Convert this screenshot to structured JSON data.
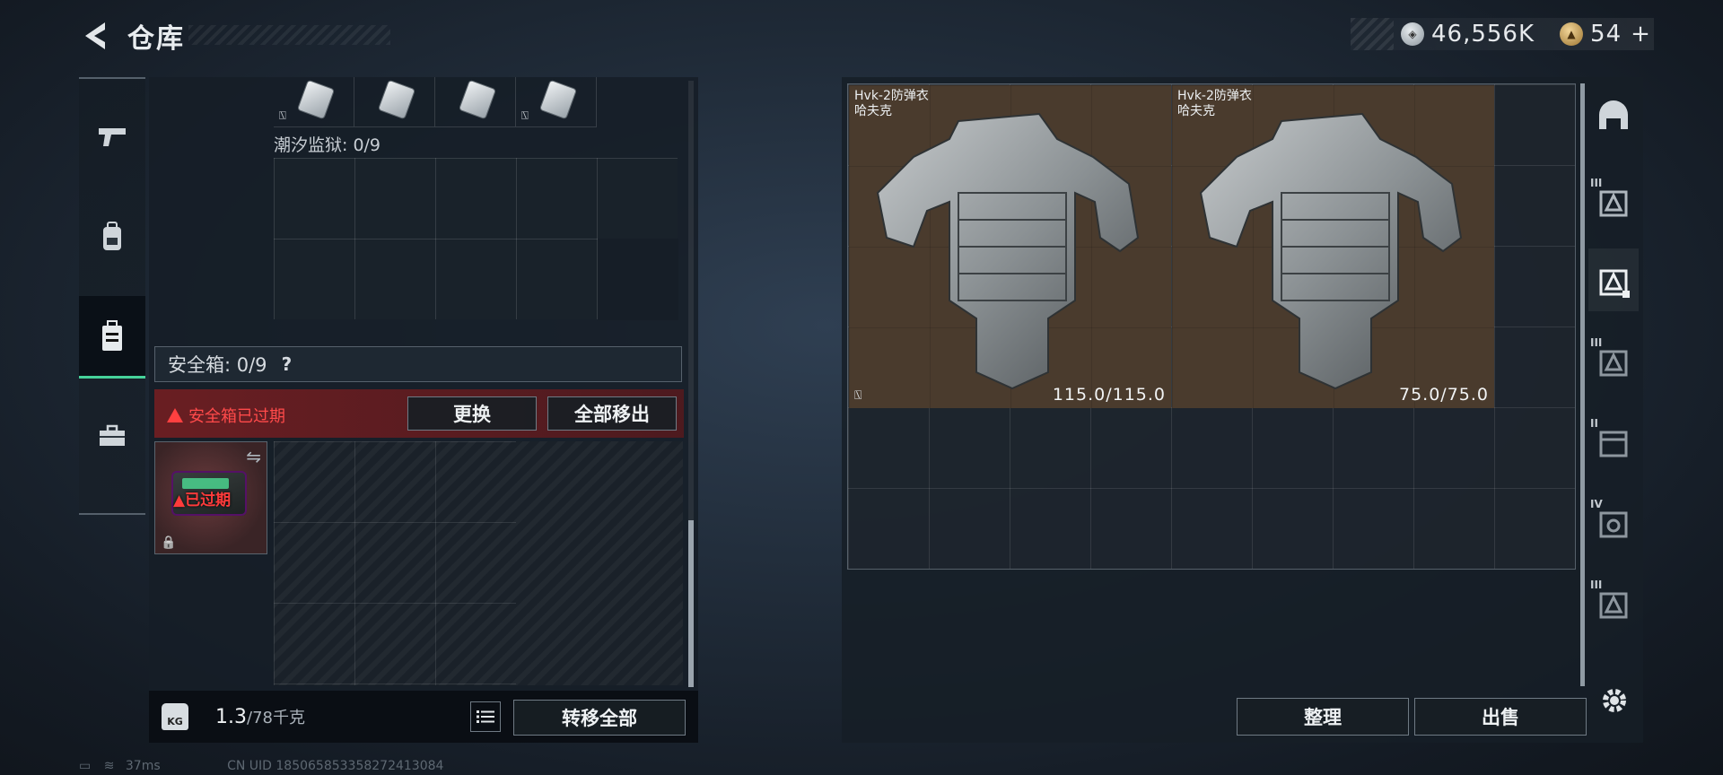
{
  "header": {
    "title": "仓库",
    "currency_silver": "46,556K",
    "currency_gold": "54",
    "gold_add": "+"
  },
  "left_nav": {
    "items": [
      {
        "icon": "pistol-icon"
      },
      {
        "icon": "backpack-icon"
      },
      {
        "icon": "safe-box-icon",
        "active": true
      },
      {
        "icon": "toolbox-icon"
      }
    ]
  },
  "container": {
    "nodeliver_glyph": "⍂",
    "prison_label": "潮汐监狱: 0/9",
    "safe_box_label": "安全箱:  0/9",
    "help_glyph": "?",
    "expired_warning": "安全箱已过期",
    "replace_button": "更换",
    "move_all_out_button": "全部移出",
    "case_expired_label": "已过期",
    "case_swap_glyph": "⇋",
    "case_lock_glyph": "🔒"
  },
  "bottom_bar": {
    "weight_icon_text": "KG",
    "weight_value": "1.3",
    "weight_capacity": "/78千克",
    "transfer_all_button": "转移全部"
  },
  "warehouse": {
    "items": [
      {
        "name": "Hvk-2防弹衣",
        "brand": "哈夫克",
        "durability": "115.0/115.0",
        "no_deliver": true
      },
      {
        "name": "Hvk-2防弹衣",
        "brand": "哈夫克",
        "durability": "75.0/75.0",
        "no_deliver": false
      }
    ],
    "sort_button": "整理",
    "sell_button": "出售"
  },
  "category_rail": {
    "items": [
      {
        "icon": "helmet-icon",
        "roman": ""
      },
      {
        "icon": "armor-tier-icon",
        "roman": "III"
      },
      {
        "icon": "armor-tier-icon",
        "roman": "",
        "active": true
      },
      {
        "icon": "armor-tier-icon",
        "roman": "III"
      },
      {
        "icon": "armor-tier-icon",
        "roman": "II"
      },
      {
        "icon": "armor-tier-icon",
        "roman": "IV"
      },
      {
        "icon": "armor-tier-icon",
        "roman": "III"
      }
    ],
    "settings_icon": "gear-icon"
  },
  "footer": {
    "ping": "37ms",
    "uid": "CN UID 1850658533582724130​84"
  },
  "colors": {
    "accent_green": "#46d29a",
    "warning_red": "#ff4040",
    "armor_card_bg": "#4a3b2d"
  }
}
